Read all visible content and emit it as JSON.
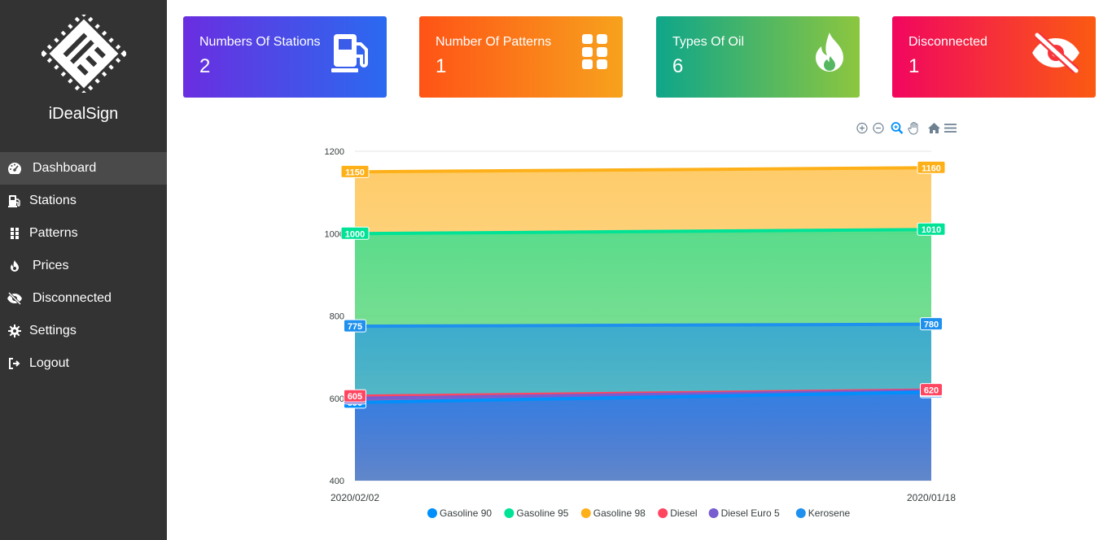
{
  "app": {
    "brand": "iDealSign"
  },
  "sidebar": {
    "items": [
      {
        "label": "Dashboard",
        "icon": "gauge-icon",
        "active": true
      },
      {
        "label": "Stations",
        "icon": "gas-pump-icon"
      },
      {
        "label": "Patterns",
        "icon": "grid-dots-icon"
      },
      {
        "label": "Prices",
        "icon": "fire-icon"
      },
      {
        "label": "Disconnected",
        "icon": "eye-slash-icon"
      },
      {
        "label": "Settings",
        "icon": "gear-icon"
      },
      {
        "label": "Logout",
        "icon": "sign-out-icon"
      }
    ]
  },
  "cards": [
    {
      "title": "Numbers Of Stations",
      "value": "2",
      "icon": "gas-pump-icon"
    },
    {
      "title": "Number Of Patterns",
      "value": "1",
      "icon": "grid-dots-icon"
    },
    {
      "title": "Types Of Oil",
      "value": "6",
      "icon": "fire-icon"
    },
    {
      "title": "Disconnected",
      "value": "1",
      "icon": "eye-slash-icon"
    }
  ],
  "chart_toolbar": [
    "zoom-in-icon",
    "zoom-out-icon",
    "zoom-select-icon",
    "pan-hand-icon",
    "home-icon",
    "menu-icon"
  ],
  "chart_data": {
    "type": "area",
    "x": [
      "2020/02/02",
      "2020/01/18"
    ],
    "ylim": [
      400,
      1200
    ],
    "yticks": [
      400,
      600,
      800,
      1000,
      1200
    ],
    "series": [
      {
        "name": "Gasoline 90",
        "color": "#008ffb",
        "values": [
          590,
          615
        ]
      },
      {
        "name": "Gasoline 95",
        "color": "#00e396",
        "values": [
          1000,
          1010
        ]
      },
      {
        "name": "Gasoline 98",
        "color": "#feb019",
        "values": [
          1150,
          1160
        ]
      },
      {
        "name": "Diesel",
        "color": "#ff4560",
        "values": [
          605,
          620
        ]
      },
      {
        "name": "Diesel Euro 5",
        "color": "#775dd0",
        "values": [
          600,
          618
        ]
      },
      {
        "name": "Kerosene",
        "color": "#1e90ee",
        "values": [
          775,
          780
        ]
      }
    ],
    "legend": "bottom-center"
  }
}
